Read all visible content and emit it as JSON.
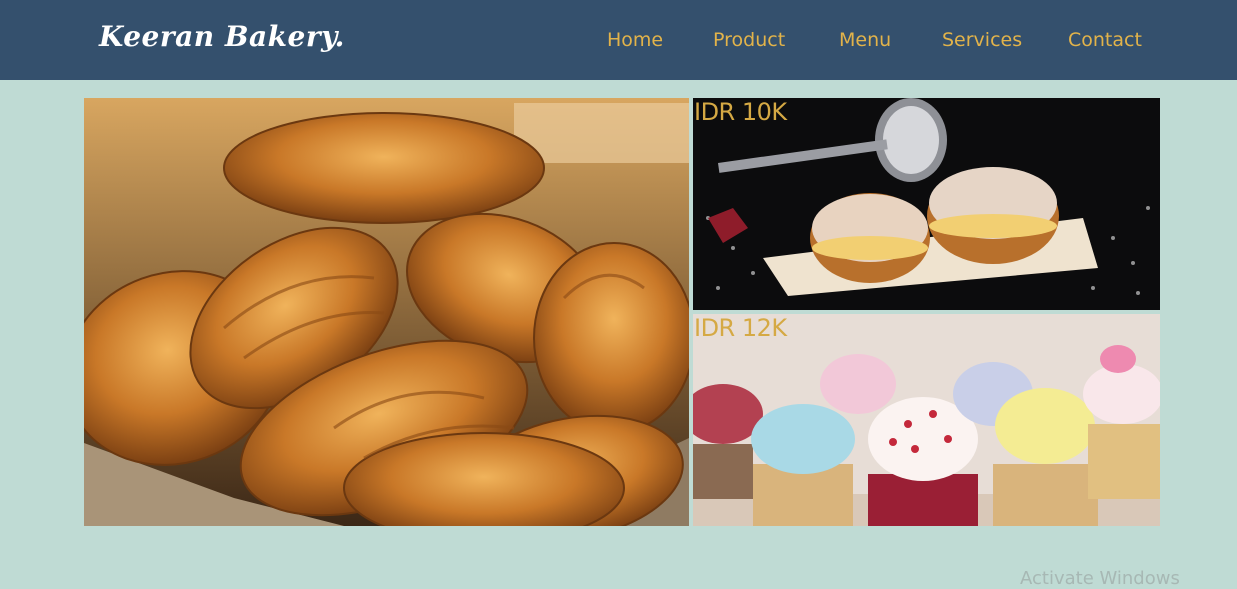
{
  "brand": {
    "name": "Keeran Bakery."
  },
  "nav": {
    "items": [
      {
        "label": "Home"
      },
      {
        "label": "Product"
      },
      {
        "label": "Menu"
      },
      {
        "label": "Services"
      },
      {
        "label": "Contact"
      }
    ]
  },
  "gallery": {
    "items": [
      {
        "price": "IDR 10K"
      },
      {
        "price": "IDR 12K"
      }
    ]
  },
  "system": {
    "watermark": "Activate Windows"
  },
  "colors": {
    "navbar": "#34506d",
    "page_bg": "#bfdbd4",
    "nav_link": "#e2b34a",
    "price": "#d5a944"
  }
}
